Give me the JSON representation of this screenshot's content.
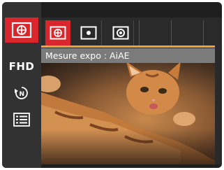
{
  "sidebar": {
    "items": [
      {
        "name": "metering-menu-icon",
        "active": true
      },
      {
        "name": "video-size-icon",
        "label": "FHD",
        "active": false
      },
      {
        "name": "face-detection-icon",
        "active": false
      },
      {
        "name": "menu-list-icon",
        "active": false
      }
    ]
  },
  "toolbar": {
    "options": [
      {
        "name": "ai-ae-metering-icon",
        "active": true
      },
      {
        "name": "spot-metering-icon",
        "active": false
      },
      {
        "name": "center-weighted-metering-icon",
        "active": false
      }
    ]
  },
  "status": {
    "label": "Mesure expo : AiAE"
  },
  "colors": {
    "accent_red": "#d9252c",
    "accent_orange": "#e8a63a",
    "sidebar_bg": "#323232"
  }
}
